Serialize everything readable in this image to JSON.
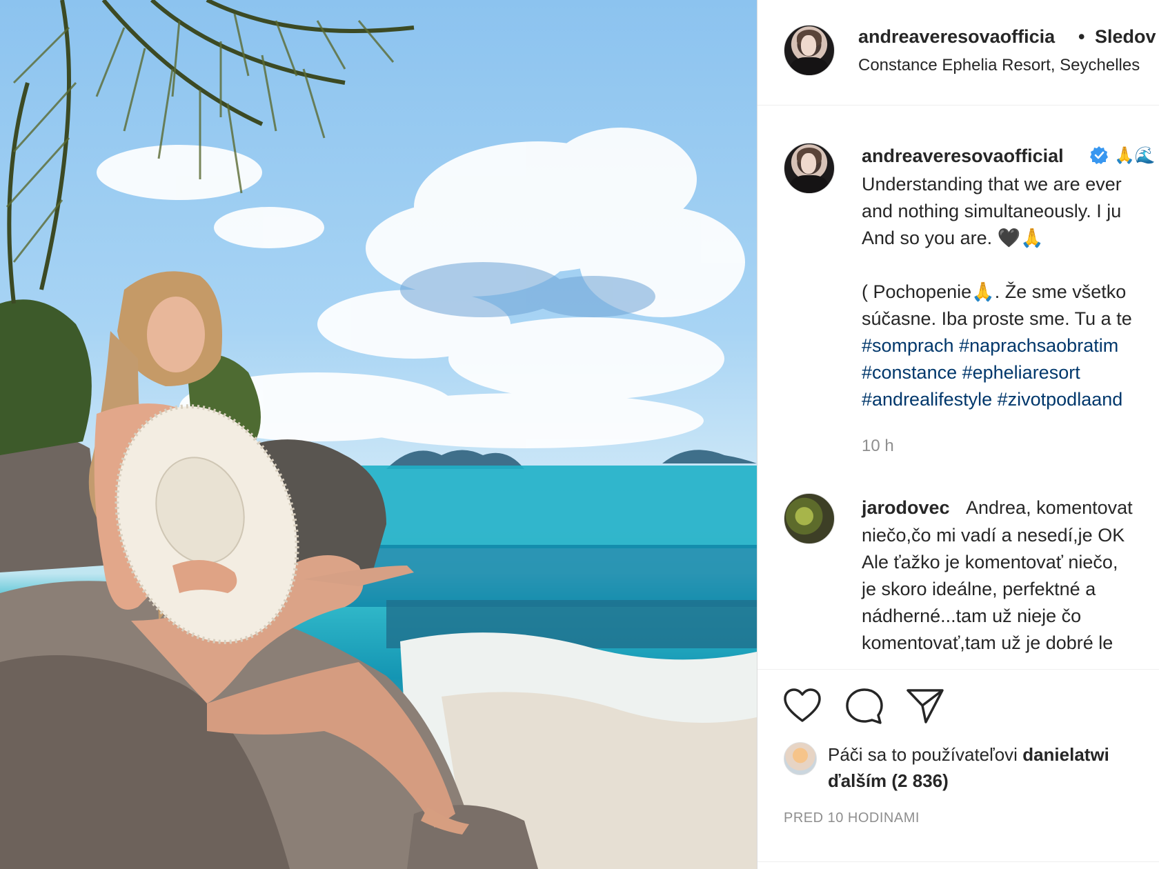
{
  "post": {
    "image_alt": "",
    "header": {
      "username": "andreaveresovaofficia",
      "separator": "•",
      "follow_label": "Sledov",
      "location": "Constance Ephelia Resort, Seychelles"
    },
    "caption": {
      "username": "andreaveresovaofficial",
      "verified_icon": "verified-badge-icon",
      "emoji_after_name": "🙏🌊",
      "lines": [
        "Understanding that we are ever",
        "and nothing simultaneously. I ju",
        "And so you are. 🖤🙏"
      ],
      "lines_sk": [
        "( Pochopenie🙏. Že sme všetko",
        "súčasne. Iba proste sme. Tu a te"
      ],
      "hashtags": [
        "#somprach #naprachsaobratim",
        "#constance #epheliaresort",
        "#andrealifestyle #zivotpodlaand"
      ],
      "time": "10 h"
    },
    "comment": {
      "username": "jarodovec",
      "first_line": "Andrea, komentovat",
      "lines": [
        "niečo,čo mi vadí a nesedí,je OK",
        "Ale ťažko je komentovať niečo,",
        "je skoro ideálne, perfektné a",
        "nádherné...tam už nieje čo",
        "komentovať,tam už je dobré le"
      ]
    },
    "actions": {
      "like_icon": "heart-icon",
      "comment_icon": "comment-bubble-icon",
      "share_icon": "paper-plane-icon",
      "likes_prefix": "Páči sa to používateľovi",
      "likes_user": "danielatwi",
      "likes_suffix": "ďalším (2 836)",
      "post_time": "PRED 10 HODINAMI"
    }
  },
  "colors": {
    "text": "#262626",
    "secondary": "#8e8e8e",
    "hashtag": "#00376b",
    "verified": "#3897f0",
    "border": "#dbdbdb"
  }
}
